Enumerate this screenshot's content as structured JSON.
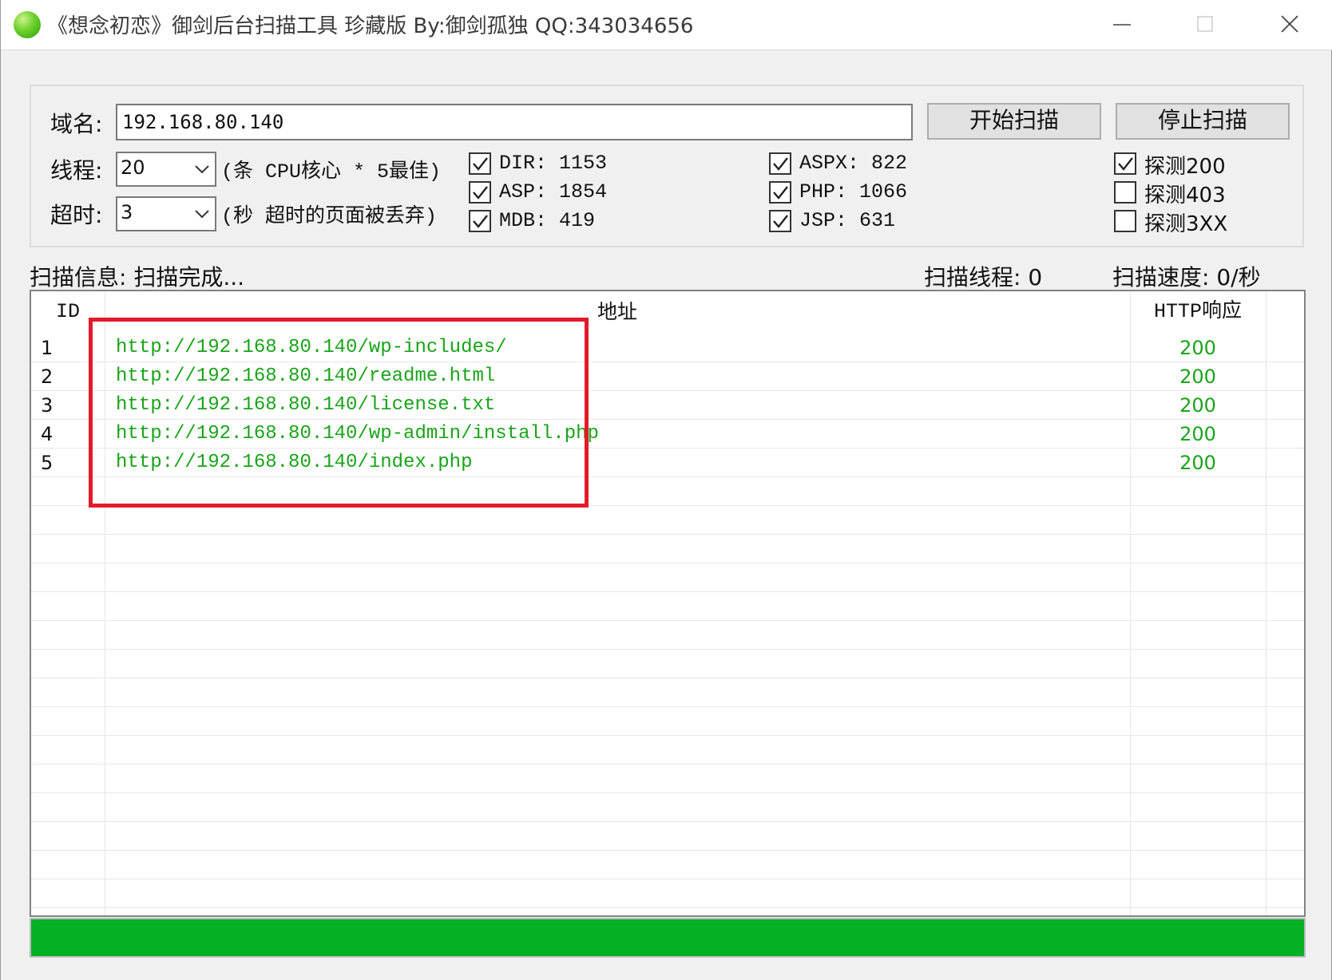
{
  "window": {
    "title": "《想念初恋》御剑后台扫描工具 珍藏版 By:御剑孤独 QQ:343034656"
  },
  "domain": {
    "label": "域名:",
    "value": "192.168.80.140"
  },
  "threads": {
    "label": "线程:",
    "value": "20",
    "hint": "(条 CPU核心 * 5最佳)"
  },
  "timeout": {
    "label": "超时:",
    "value": "3",
    "hint": "(秒 超时的页面被丢弃)"
  },
  "buttons": {
    "start": "开始扫描",
    "stop": "停止扫描"
  },
  "dicts": [
    {
      "label": "DIR: 1153",
      "checked": true
    },
    {
      "label": "ASP: 1854",
      "checked": true
    },
    {
      "label": "MDB: 419",
      "checked": true
    },
    {
      "label": "ASPX: 822",
      "checked": true
    },
    {
      "label": "PHP: 1066",
      "checked": true
    },
    {
      "label": "JSP: 631",
      "checked": true
    }
  ],
  "probes": [
    {
      "label": "探测200",
      "checked": true
    },
    {
      "label": "探测403",
      "checked": false
    },
    {
      "label": "探测3XX",
      "checked": false
    }
  ],
  "status": {
    "info": "扫描信息: 扫描完成...",
    "threads": "扫描线程: 0",
    "speed": "扫描速度: 0/秒"
  },
  "table": {
    "columns": [
      "ID",
      "地址",
      "HTTP响应"
    ],
    "rows": [
      {
        "id": "1",
        "url": "http://192.168.80.140/wp-includes/",
        "code": "200"
      },
      {
        "id": "2",
        "url": "http://192.168.80.140/readme.html",
        "code": "200"
      },
      {
        "id": "3",
        "url": "http://192.168.80.140/license.txt",
        "code": "200"
      },
      {
        "id": "4",
        "url": "http://192.168.80.140/wp-admin/install.php",
        "code": "200"
      },
      {
        "id": "5",
        "url": "http://192.168.80.140/index.php",
        "code": "200"
      }
    ]
  },
  "progress": {
    "percent": 100,
    "color": "#06b025"
  },
  "colors": {
    "url_text": "#1aa31a",
    "highlight": "#e21a2a",
    "progress": "#06b025"
  }
}
